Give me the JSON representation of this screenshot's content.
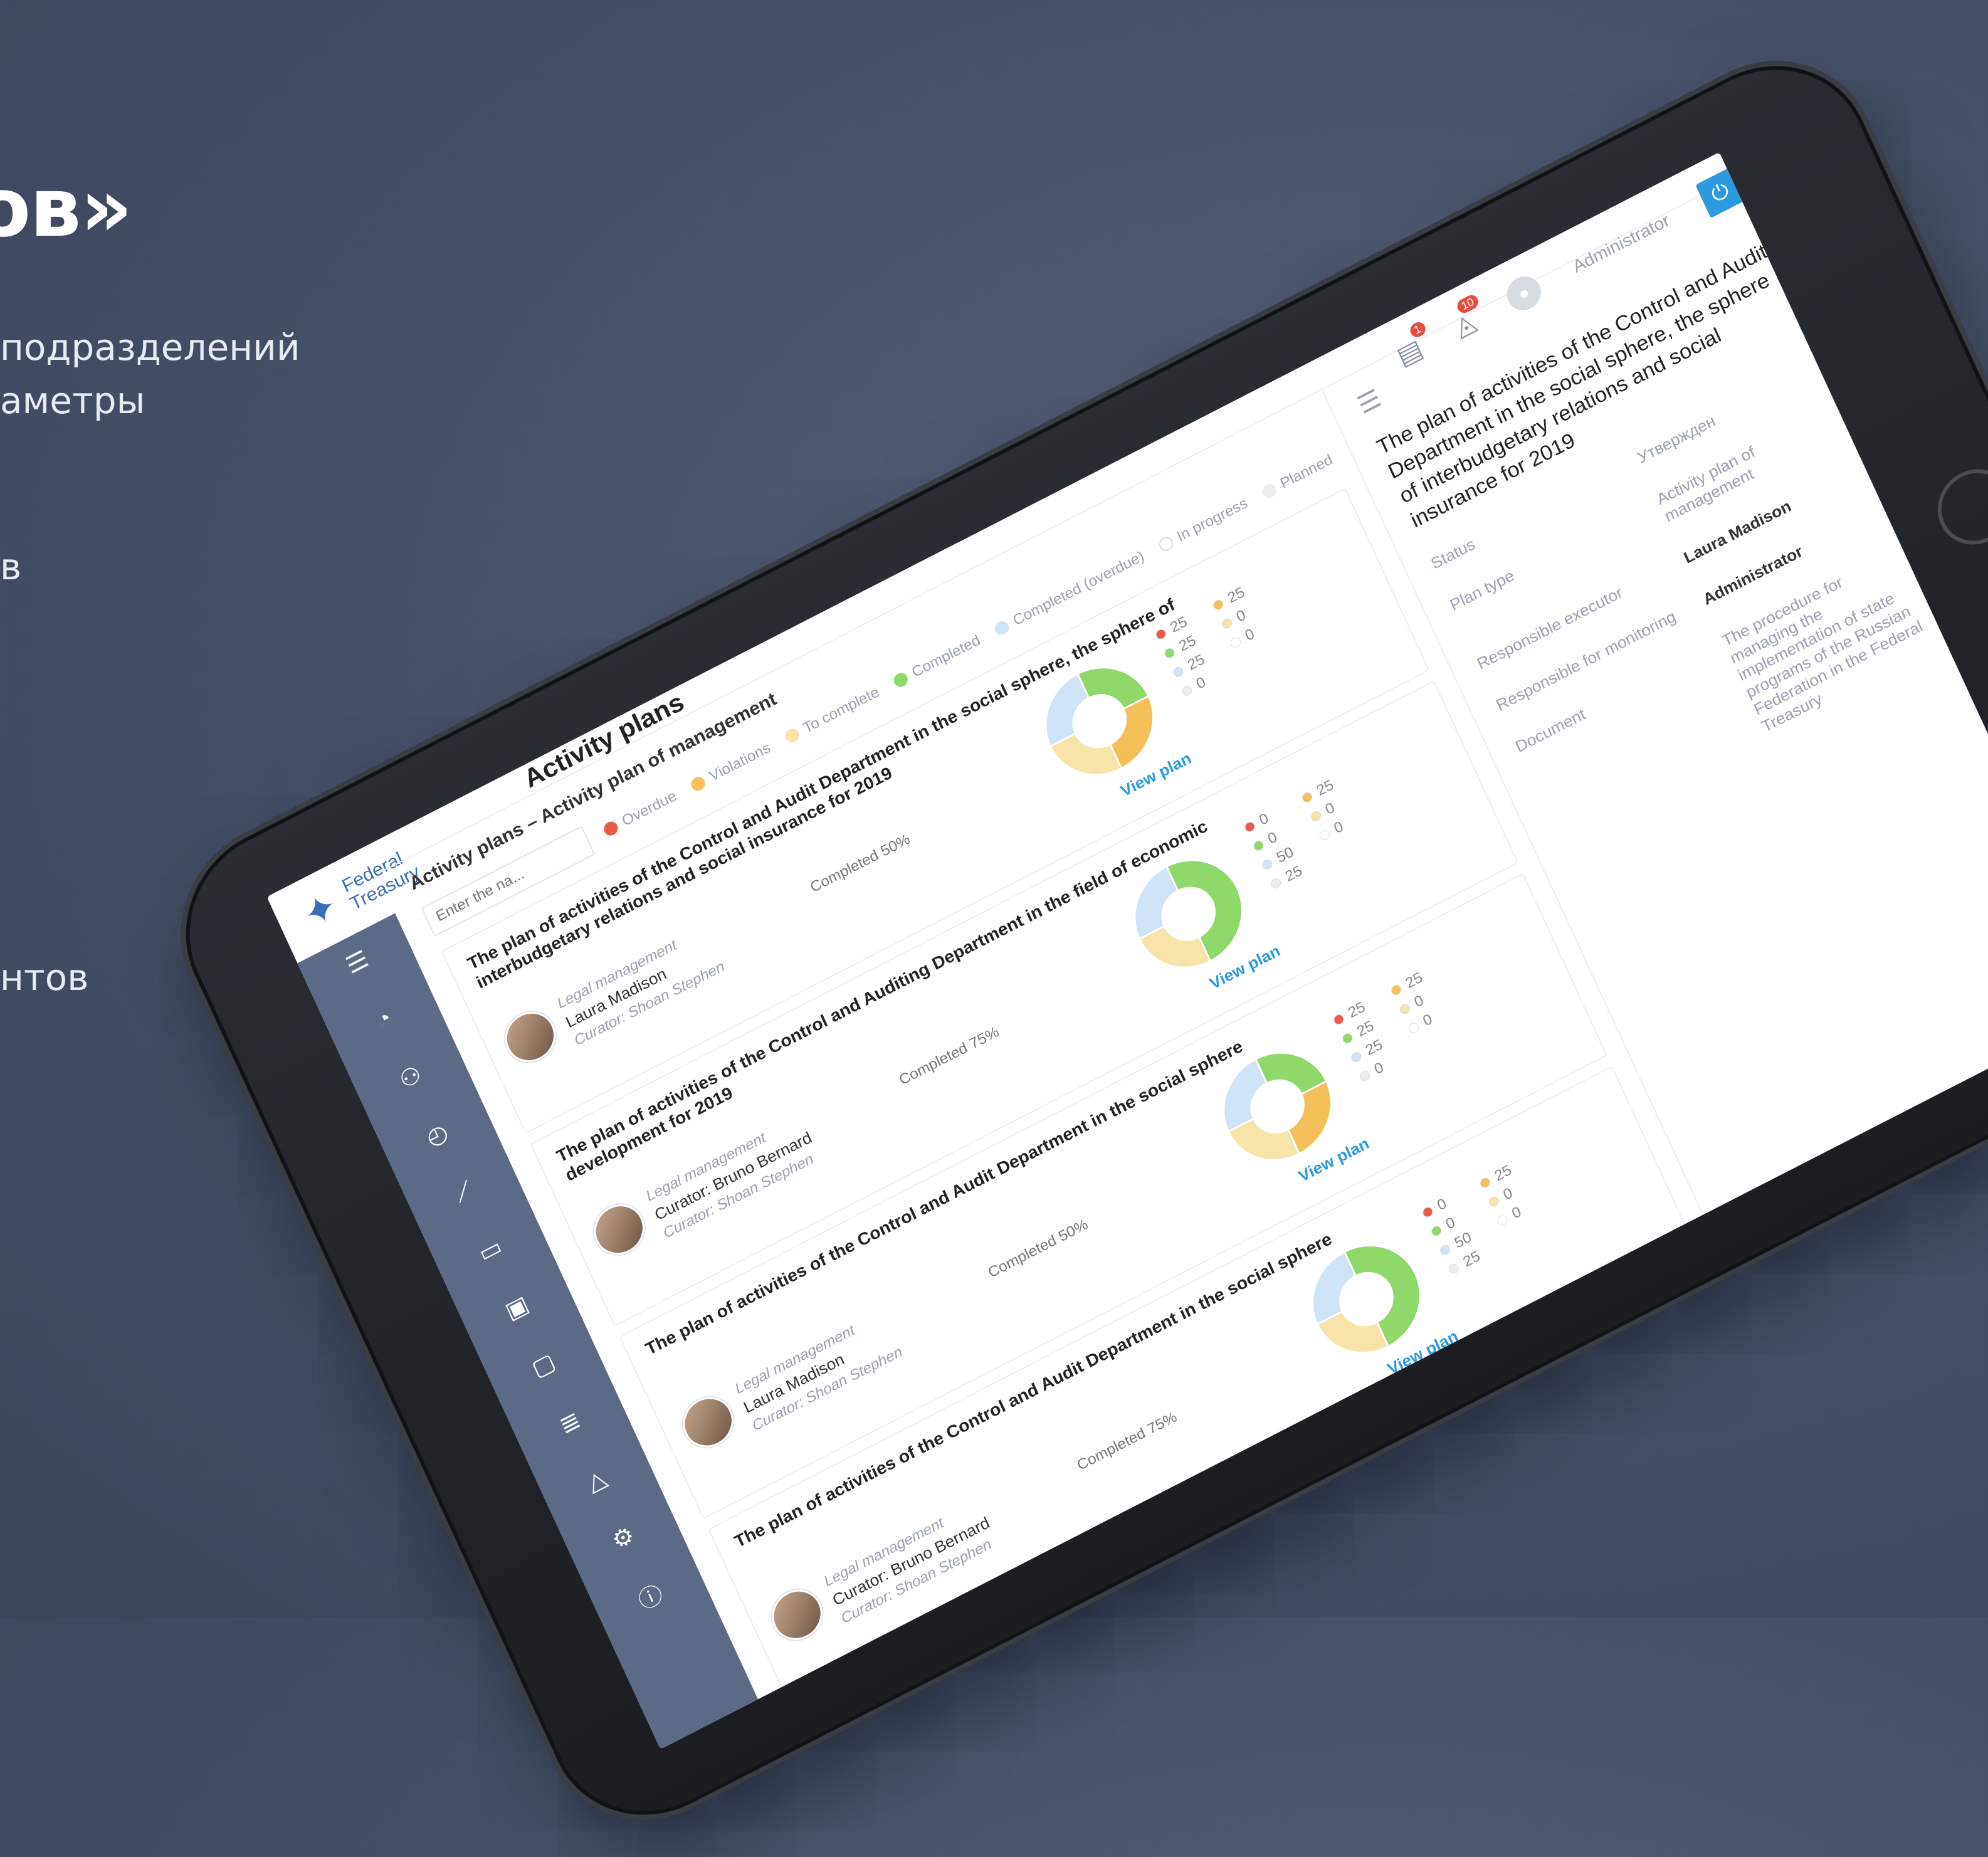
{
  "promo": {
    "heading_fragment": "ов»",
    "line1": "подразделений",
    "line2": "аметры",
    "line3": "в",
    "line4": "нтов"
  },
  "app": {
    "logo_line1": "Federal",
    "logo_line2": "Treasury",
    "page_title": "Activity plans",
    "notifications_count": "1",
    "messages_count": "10",
    "user_role": "Administrator"
  },
  "sidebar": {
    "icons": [
      "menu-icon",
      "dashboard-icon",
      "users-icon",
      "gauge-icon",
      "chart-icon",
      "book-icon",
      "image-icon",
      "monitor-icon",
      "list-icon",
      "warning-icon",
      "settings-icon",
      "info-icon"
    ]
  },
  "list": {
    "breadcrumb": "Activity plans – Activity plan of management",
    "search_placeholder": "Enter the na...",
    "legend": [
      {
        "label": "Overdue",
        "color": "#ea5a47"
      },
      {
        "label": "Violations",
        "color": "#f5c05a"
      },
      {
        "label": "To complete",
        "color": "#f6e4a8"
      },
      {
        "label": "Completed",
        "color": "#8fd86a"
      },
      {
        "label": "Completed (overdue)",
        "color": "#cfe4f6"
      },
      {
        "label": "In progress",
        "color": "#ffffff"
      },
      {
        "label": "Planned",
        "color": "#eeeeee"
      }
    ],
    "plans": [
      {
        "title": "The plan of activities of the Control and Audit Department in the social sphere, the sphere of interbudgetary relations and social insurance for 2019",
        "dept": "Legal management",
        "person": "Laura Madison",
        "curator": "Curator: Shoan Stephen",
        "completed": "Completed 50%",
        "link": "View plan",
        "stats": [
          "25",
          "25",
          "25",
          "0",
          "25",
          "0",
          "0"
        ]
      },
      {
        "title": "The plan of activities of the Control and Auditing Department in the field of economic development for 2019",
        "dept": "Legal management",
        "person": "Curator: Bruno Bernard",
        "curator": "Curator: Shoan Stephen",
        "completed": "Completed 75%",
        "link": "View plan",
        "stats": [
          "0",
          "25",
          "0",
          "0",
          "50",
          "0",
          "25"
        ]
      },
      {
        "title": "The plan of activities of the Control and Audit Department in the social sphere",
        "dept": "Legal management",
        "person": "Laura Madison",
        "curator": "Curator: Shoan Stephen",
        "completed": "Completed 50%",
        "link": "View plan",
        "stats": [
          "25",
          "25",
          "25",
          "0",
          "25",
          "0",
          "0"
        ]
      },
      {
        "title": "The plan of activities of the Control and Audit Department in the social sphere",
        "dept": "Legal management",
        "person": "Curator: Bruno Bernard",
        "curator": "Curator: Shoan Stephen",
        "completed": "Completed 75%",
        "link": "View plan",
        "stats": [
          "0",
          "25",
          "0",
          "0",
          "50",
          "0",
          "25"
        ]
      }
    ]
  },
  "detail": {
    "title": "The plan of activities of the Control and Audit Department in the social sphere, the sphere of interbudgetary relations and social insurance for 2019",
    "rows": [
      {
        "label": "Status",
        "value": "Утвержден"
      },
      {
        "label": "Plan type",
        "value": "Activity plan of management"
      },
      {
        "label": "Responsible executor",
        "value": "Laura Madison"
      },
      {
        "label": "Responsible for monitoring",
        "value": "Administrator"
      },
      {
        "label": "Document",
        "value": "The procedure for managing the implementation of state programs of the Russian Federation in the Federal Treasury"
      }
    ]
  }
}
